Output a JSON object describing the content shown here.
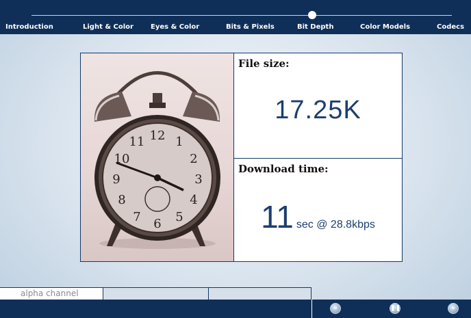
{
  "nav": {
    "items": [
      {
        "label": "Introduction"
      },
      {
        "label": "Light & Color"
      },
      {
        "label": "Eyes & Color"
      },
      {
        "label": "Bits & Pixels"
      },
      {
        "label": "Bit Depth",
        "active": true
      },
      {
        "label": "Color Models"
      },
      {
        "label": "Codecs"
      }
    ]
  },
  "info": {
    "file_size_label": "File size:",
    "file_size_value": "17.25K",
    "download_label": "Download time:",
    "download_value": "11",
    "download_unit": "sec @ 28.8kbps"
  },
  "tabs": {
    "alpha_label": "alpha channel"
  },
  "controls": {
    "back_icon": "double-chevron-left-icon",
    "pause_icon": "pause-icon",
    "forward_icon": "double-chevron-right-icon"
  },
  "colors": {
    "navy": "#0f2f58",
    "value_text": "#1b3e6e"
  }
}
